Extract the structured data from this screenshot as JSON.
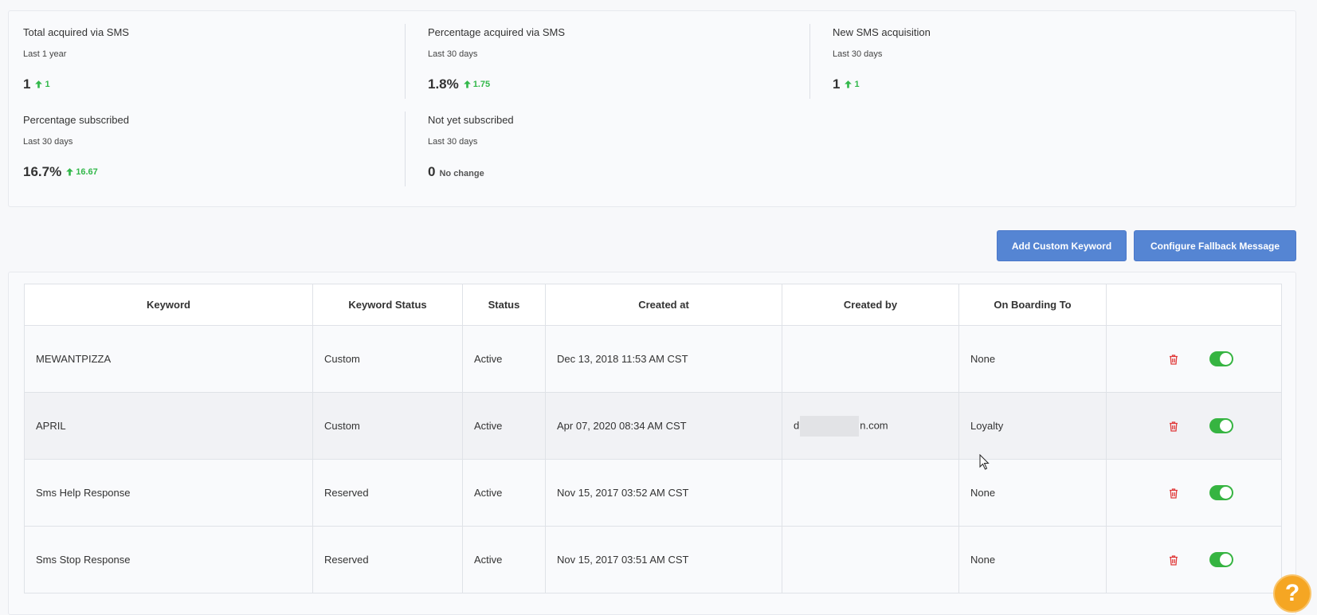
{
  "stats": [
    {
      "title": "Total acquired via SMS",
      "period": "Last 1 year",
      "value": "1",
      "delta": "1",
      "trend": "up"
    },
    {
      "title": "Percentage acquired via SMS",
      "period": "Last 30 days",
      "value": "1.8%",
      "delta": "1.75",
      "trend": "up"
    },
    {
      "title": "New SMS acquisition",
      "period": "Last 30 days",
      "value": "1",
      "delta": "1",
      "trend": "up"
    },
    {
      "title": "Percentage subscribed",
      "period": "Last 30 days",
      "value": "16.7%",
      "delta": "16.67",
      "trend": "up"
    },
    {
      "title": "Not yet subscribed",
      "period": "Last 30 days",
      "value": "0",
      "delta": "No change",
      "trend": "none"
    }
  ],
  "actions": {
    "add_keyword": "Add Custom Keyword",
    "configure_fallback": "Configure Fallback Message"
  },
  "table": {
    "headers": [
      "Keyword",
      "Keyword Status",
      "Status",
      "Created at",
      "Created by",
      "On Boarding To",
      ""
    ],
    "rows": [
      {
        "keyword": "MEWANTPIZZA",
        "keyword_status": "Custom",
        "status": "Active",
        "created_at": "Dec 13, 2018 11:53 AM CST",
        "created_by_prefix": "",
        "created_by_suffix": "",
        "onboarding": "None",
        "enabled": true
      },
      {
        "keyword": "APRIL",
        "keyword_status": "Custom",
        "status": "Active",
        "created_at": "Apr 07, 2020 08:34 AM CST",
        "created_by_prefix": "d",
        "created_by_suffix": "n.com",
        "onboarding": "Loyalty",
        "enabled": true
      },
      {
        "keyword": "Sms Help Response",
        "keyword_status": "Reserved",
        "status": "Active",
        "created_at": "Nov 15, 2017 03:52 AM CST",
        "created_by_prefix": "",
        "created_by_suffix": "",
        "onboarding": "None",
        "enabled": true
      },
      {
        "keyword": "Sms Stop Response",
        "keyword_status": "Reserved",
        "status": "Active",
        "created_at": "Nov 15, 2017 03:51 AM CST",
        "created_by_prefix": "",
        "created_by_suffix": "",
        "onboarding": "None",
        "enabled": true
      }
    ]
  },
  "help": {
    "label": "?"
  },
  "colors": {
    "accent": "#5585d3",
    "positive": "#32b84a",
    "toggle_on": "#36b441",
    "danger": "#e03a3a",
    "help": "#f5a623"
  },
  "icons": [
    "arrow-up-icon",
    "trash-icon",
    "toggle-switch",
    "help-icon",
    "cursor-icon"
  ]
}
